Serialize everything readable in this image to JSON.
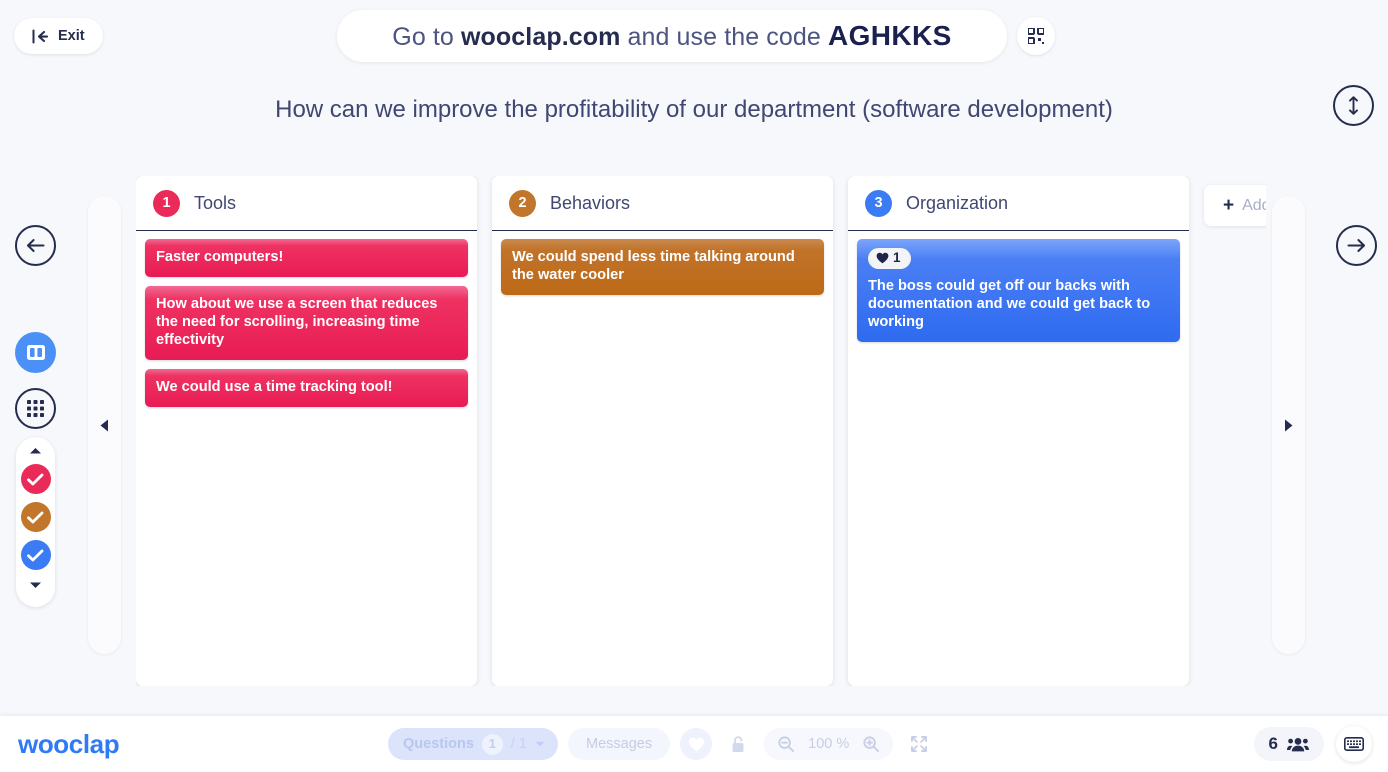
{
  "header": {
    "exit_label": "Exit",
    "banner_prefix": "Go to ",
    "banner_domain": "wooclap.com",
    "banner_middle": " and use the code ",
    "banner_code": "AGHKKS",
    "qr_icon": "qr-code-icon",
    "expand_icon": "expand-vertical-icon"
  },
  "question": {
    "text": "How can we improve the profitability of our department (software development)"
  },
  "nav": {
    "prev_icon": "arrow-left-icon",
    "next_icon": "arrow-right-icon",
    "slide_left_icon": "triangle-left-icon",
    "slide_right_icon": "triangle-right-icon"
  },
  "rail": {
    "columns_view_icon": "columns-view-icon",
    "grid_view_icon": "grid-view-icon",
    "scroll_up_icon": "caret-up-icon",
    "scroll_down_icon": "caret-down-icon",
    "filters": [
      {
        "name": "filter-tools",
        "color": "#ea2a58",
        "icon": "check-circle-icon"
      },
      {
        "name": "filter-behaviors",
        "color": "#c1762b",
        "icon": "check-circle-icon"
      },
      {
        "name": "filter-organization",
        "color": "#3b7bf3",
        "icon": "check-circle-icon"
      }
    ]
  },
  "board": {
    "columns": [
      {
        "number": "1",
        "title": "Tools",
        "color": "#ea2a58",
        "cards": [
          {
            "text": "Faster computers!",
            "votes": null
          },
          {
            "text": "How about we use a screen that reduces the need for scrolling, increasing time effectivity",
            "votes": null
          },
          {
            "text": "We could use a time tracking tool!",
            "votes": null
          }
        ]
      },
      {
        "number": "2",
        "title": "Behaviors",
        "color": "#c1762b",
        "cards": [
          {
            "text": "We could spend less time talking around the water cooler",
            "votes": null
          }
        ]
      },
      {
        "number": "3",
        "title": "Organization",
        "color": "#3b7bf3",
        "cards": [
          {
            "text": "The boss could get off our backs with documentation and we could get back to working",
            "votes": "1"
          }
        ]
      }
    ],
    "add_column_label": "Add",
    "add_column_icon": "plus-icon",
    "vote_icon": "heart-icon"
  },
  "bottom": {
    "logo": "wooclap",
    "questions_label": "Questions",
    "questions_current": "1",
    "questions_separator": "/ 1",
    "questions_caret_icon": "caret-down-icon",
    "messages_label": "Messages",
    "heart_icon": "heart-icon",
    "lock_icon": "lock-icon",
    "zoom_out_icon": "zoom-out-icon",
    "zoom_level": "100 %",
    "zoom_in_icon": "zoom-in-icon",
    "fullscreen_icon": "fullscreen-icon",
    "participants_count": "6",
    "participants_icon": "people-icon",
    "keyboard_icon": "keyboard-icon"
  },
  "colors": {
    "brand_blue": "#2f7bf6",
    "navy": "#262c4e",
    "page_bg": "#f7f8fb"
  }
}
